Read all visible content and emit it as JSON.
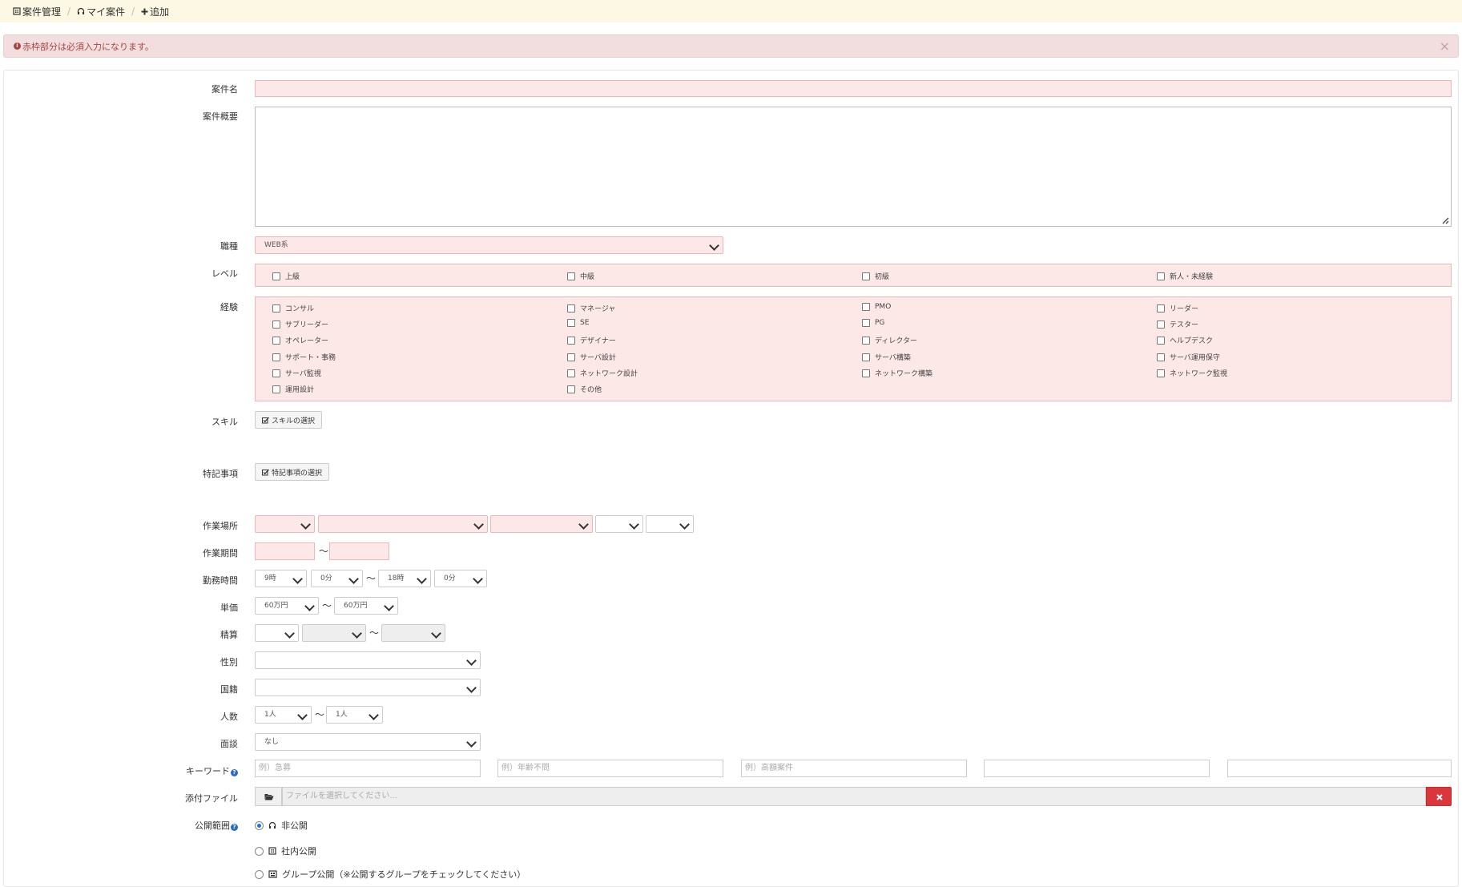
{
  "breadcrumb": {
    "items": [
      "案件管理",
      "マイ案件",
      "追加"
    ],
    "separator": "/"
  },
  "alert": {
    "message": "赤枠部分は必須入力になります。",
    "close": "×"
  },
  "labels": {
    "title": "案件名",
    "summary": "案件概要",
    "job_type": "職種",
    "level": "レベル",
    "experience": "経験",
    "skills": "スキル",
    "notes": "特記事項",
    "location": "作業場所",
    "period": "作業期間",
    "hours": "勤務時間",
    "price": "単価",
    "settlement": "精算",
    "gender": "性別",
    "nationality": "国籍",
    "headcount": "人数",
    "interview": "面談",
    "keywords": "キーワード",
    "attachment": "添付ファイル",
    "visibility": "公開範囲"
  },
  "job_type": {
    "value": "WEB系"
  },
  "level": {
    "options": [
      "上級",
      "中級",
      "初級",
      "新人・未経験"
    ]
  },
  "experience": {
    "options": [
      "コンサル",
      "マネージャ",
      "PMO",
      "リーダー",
      "サブリーダー",
      "SE",
      "PG",
      "テスター",
      "オペレーター",
      "デザイナー",
      "ディレクター",
      "ヘルプデスク",
      "サポート・事務",
      "サーバ設計",
      "サーバ構築",
      "サーバ運用保守",
      "サーバ監視",
      "ネットワーク設計",
      "ネットワーク構築",
      "ネットワーク監視",
      "運用設計",
      "その他"
    ]
  },
  "buttons": {
    "skills": "スキルの選択",
    "notes": "特記事項の選択"
  },
  "hours": {
    "start_h": "9時",
    "start_m": "0分",
    "end_h": "18時",
    "end_m": "0分"
  },
  "price": {
    "min": "60万円",
    "max": "60万円"
  },
  "headcount": {
    "min": "1人",
    "max": "1人"
  },
  "interview": {
    "value": "なし"
  },
  "tilde": "〜",
  "keywords": {
    "placeholders": [
      "例）急募",
      "例）年齢不問",
      "例）高額案件",
      "",
      ""
    ]
  },
  "attachment": {
    "placeholder": "ファイルを選択してください..."
  },
  "visibility": {
    "options": [
      "非公開",
      "社内公開",
      "グループ公開（※公開するグループをチェックしてください）"
    ],
    "selected": 0
  },
  "colors": {
    "error_bg": "#fde8e8",
    "error_border": "#f0b5b5",
    "alert_bg": "#f2dede",
    "alert_text": "#a94442",
    "breadcrumb_bg": "#fcf8e3",
    "danger": "#d9363e",
    "help_icon": "#2a6ebb"
  }
}
